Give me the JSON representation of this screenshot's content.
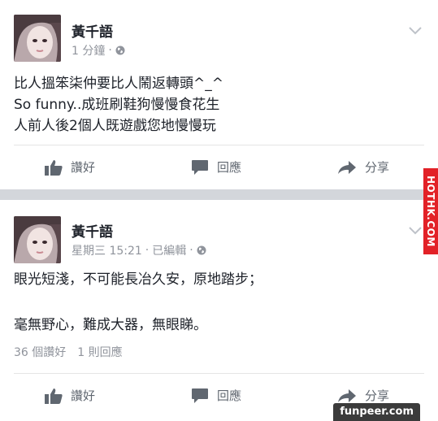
{
  "post1": {
    "author": "黃千語",
    "time": "1 分鐘",
    "dot": "·",
    "lines": [
      "比人搵笨柒仲要比人鬧返轉頭^_^",
      "So funny..成班刷鞋狗慢慢食花生",
      "人前人後2個人既遊戲您地慢慢玩"
    ],
    "actions": {
      "like": "讚好",
      "comment": "回應",
      "share": "分享"
    }
  },
  "post2": {
    "author": "黃千語",
    "time": "星期三 15:21",
    "dot1": "·",
    "edited": "已編輯",
    "dot2": "·",
    "lines": [
      "眼光短淺，不可能長冶久安，原地踏步；",
      "",
      "毫無野心，難成大器，無眼睇。"
    ],
    "stats": {
      "likes": "36 個讚好",
      "comments": "1 則回應"
    },
    "actions": {
      "like": "讚好",
      "comment": "回應",
      "share": "分享"
    }
  },
  "side_badge": "HOTHK.COM",
  "watermark": "funpeer.com",
  "icons": {
    "like": "thumbs-up-icon",
    "comment": "comment-icon",
    "share": "share-arrow-icon",
    "privacy": "globe-icon",
    "options": "chevron-down-icon"
  },
  "colors": {
    "text": "#1d2129",
    "meta": "#90949c",
    "action": "#606770",
    "separator": "#d3d6db",
    "badge": "#e22127"
  }
}
